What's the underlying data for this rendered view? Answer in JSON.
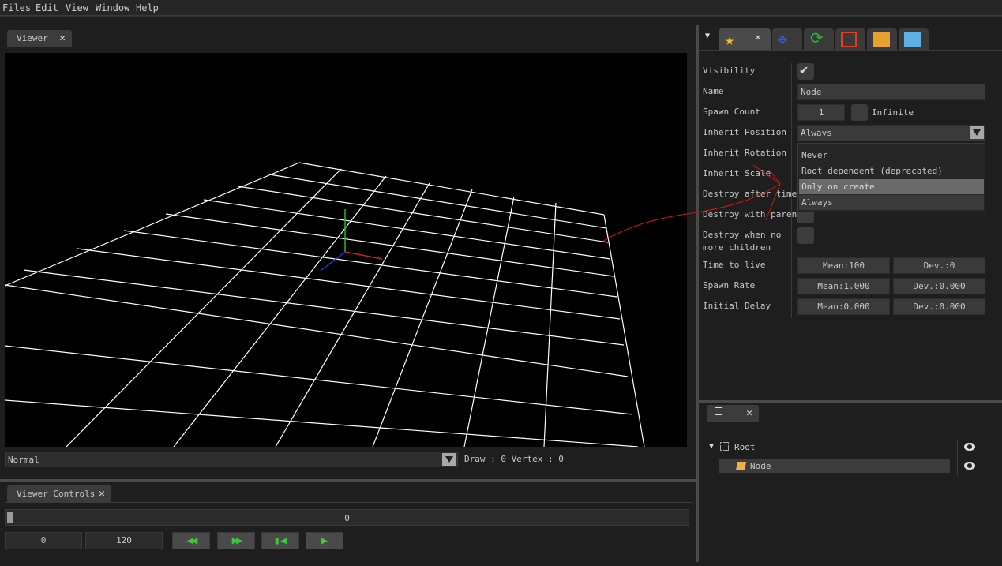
{
  "menu": [
    "Files",
    "Edit",
    "View",
    "Window",
    "Help"
  ],
  "viewer": {
    "tab_label": "Viewer",
    "mode": "Normal",
    "stats": "Draw : 0 Vertex : 0"
  },
  "controls": {
    "tab_label": "Viewer Controls",
    "timeline_value": "0",
    "start_frame": "0",
    "end_frame": "120",
    "buttons": [
      "rewind-icon",
      "fast-forward-icon",
      "skip-to-start-icon",
      "play-icon"
    ]
  },
  "properties": {
    "tabs": [
      "star-icon",
      "move-icon",
      "rotate-icon",
      "scale-icon",
      "box-icon",
      "cube-icon"
    ],
    "labels": {
      "visibility": "Visibility",
      "name": "Name",
      "spawn_count": "Spawn Count",
      "inherit_position": "Inherit Position",
      "inherit_rotation": "Inherit Rotation",
      "inherit_scale": "Inherit Scale",
      "destroy_after_time": "Destroy after time",
      "destroy_with_parent": "Destroy with parent",
      "destroy_when_no_children_1": "Destroy when no",
      "destroy_when_no_children_2": "more children",
      "time_to_live": "Time to live",
      "spawn_rate": "Spawn Rate",
      "initial_delay": "Initial Delay"
    },
    "name_value": "Node",
    "spawn_count_value": "1",
    "infinite_label": "Infinite",
    "inherit_position_value": "Always",
    "options": [
      "Never",
      "Root dependent (deprecated)",
      "Only on create",
      "Always"
    ],
    "time_to_live": {
      "mean": "Mean:100",
      "dev": "Dev.:0"
    },
    "spawn_rate": {
      "mean": "Mean:1.000",
      "dev": "Dev.:0.000"
    },
    "initial_delay": {
      "mean": "Mean:0.000",
      "dev": "Dev.:0.000"
    }
  },
  "tree": {
    "root": "Root",
    "node": "Node"
  },
  "colors": {
    "accent_green": "#3cc83c",
    "annotation_red": "#d01818"
  }
}
